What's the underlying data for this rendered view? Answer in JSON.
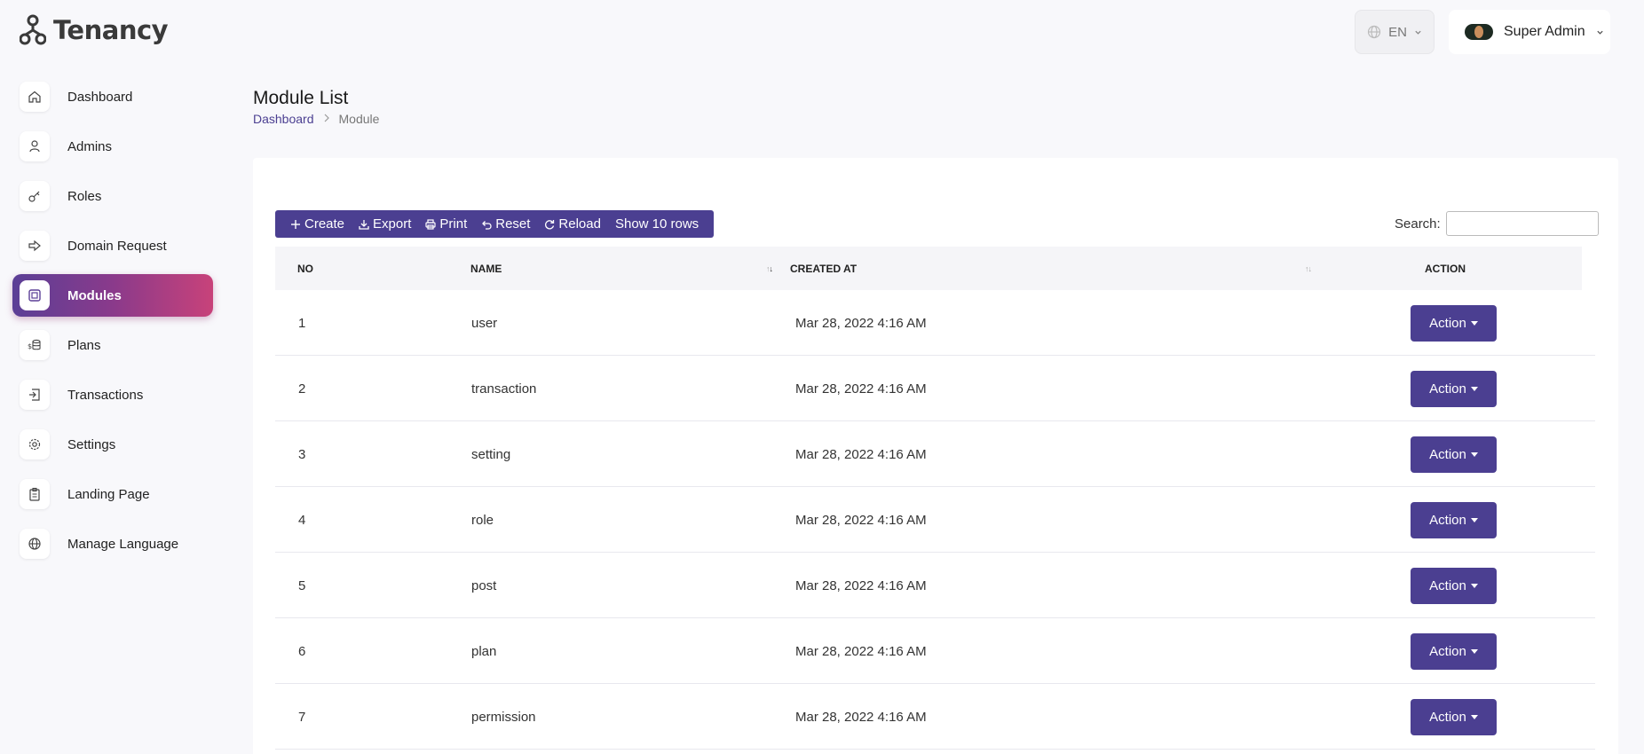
{
  "brand": {
    "name": "Tenancy"
  },
  "header": {
    "language": "EN",
    "user_name": "Super Admin"
  },
  "sidebar": {
    "items": [
      {
        "label": "Dashboard",
        "icon": "home-icon"
      },
      {
        "label": "Admins",
        "icon": "user-icon"
      },
      {
        "label": "Roles",
        "icon": "key-icon"
      },
      {
        "label": "Domain Request",
        "icon": "arrow-right-icon"
      },
      {
        "label": "Modules",
        "icon": "module-icon",
        "active": true
      },
      {
        "label": "Plans",
        "icon": "coins-icon"
      },
      {
        "label": "Transactions",
        "icon": "transaction-icon"
      },
      {
        "label": "Settings",
        "icon": "gear-icon"
      },
      {
        "label": "Landing Page",
        "icon": "clipboard-icon"
      },
      {
        "label": "Manage Language",
        "icon": "globe-icon"
      }
    ]
  },
  "page": {
    "title": "Module List",
    "breadcrumb": {
      "root": "Dashboard",
      "current": "Module"
    }
  },
  "toolbar": {
    "create": "Create",
    "export": "Export",
    "print": "Print",
    "reset": "Reset",
    "reload": "Reload",
    "page_length": "Show 10 rows"
  },
  "search": {
    "label": "Search:",
    "value": ""
  },
  "table": {
    "columns": [
      "NO",
      "NAME",
      "CREATED AT",
      "ACTION"
    ],
    "action_label": "Action",
    "rows": [
      {
        "no": "1",
        "name": "user",
        "created_at": "Mar 28, 2022 4:16 AM"
      },
      {
        "no": "2",
        "name": "transaction",
        "created_at": "Mar 28, 2022 4:16 AM"
      },
      {
        "no": "3",
        "name": "setting",
        "created_at": "Mar 28, 2022 4:16 AM"
      },
      {
        "no": "4",
        "name": "role",
        "created_at": "Mar 28, 2022 4:16 AM"
      },
      {
        "no": "5",
        "name": "post",
        "created_at": "Mar 28, 2022 4:16 AM"
      },
      {
        "no": "6",
        "name": "plan",
        "created_at": "Mar 28, 2022 4:16 AM"
      },
      {
        "no": "7",
        "name": "permission",
        "created_at": "Mar 28, 2022 4:16 AM"
      }
    ]
  },
  "colors": {
    "primary": "#4b3f91",
    "active_gradient_start": "#5b3f96",
    "active_gradient_end": "#c8427a",
    "background": "#f8f8fb"
  }
}
